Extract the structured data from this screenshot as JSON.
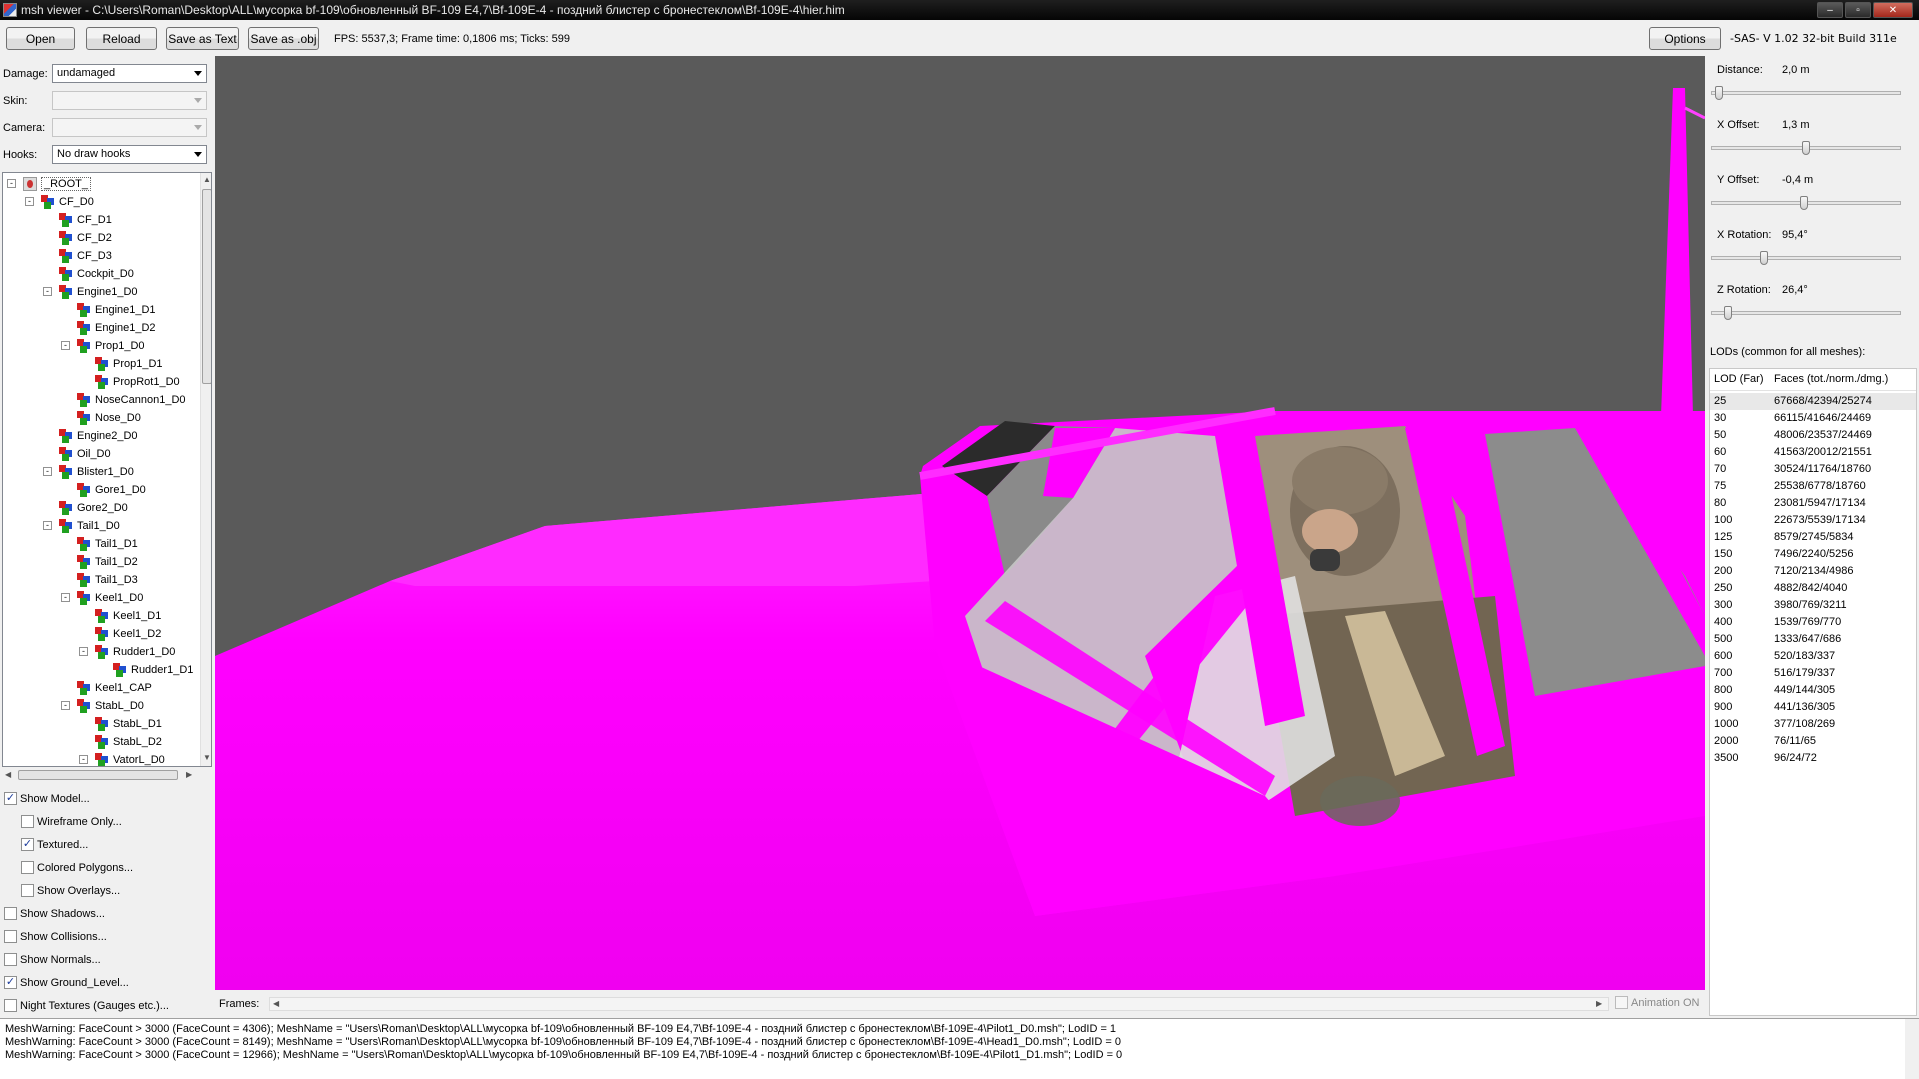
{
  "window": {
    "title": "msh viewer - C:\\Users\\Roman\\Desktop\\ALL\\мусорка bf-109\\обновленный BF-109 E4,7\\Bf-109E-4 - поздний блистер с бронестеклом\\Bf-109E-4\\hier.him",
    "controls": [
      "–",
      "▫",
      "✕"
    ]
  },
  "toolbar": {
    "open_label": "Open",
    "reload_label": "Reload",
    "save_text_label": "Save as Text",
    "save_obj_label": "Save as .obj",
    "fps_text": "FPS: 5537,3; Frame time: 0,1806 ms; Ticks: 599",
    "options_label": "Options",
    "version_text": "-SAS- V 1.02  32-bit  Build 311e"
  },
  "left": {
    "damage_label": "Damage:",
    "damage_value": "undamaged",
    "skin_label": "Skin:",
    "skin_value": "",
    "camera_label": "Camera:",
    "camera_value": "",
    "hooks_label": "Hooks:",
    "hooks_value": "No draw hooks",
    "tree": [
      {
        "label": "_ROOT_",
        "level": 0,
        "exp": "-",
        "root": true
      },
      {
        "label": "CF_D0",
        "level": 1,
        "exp": "-"
      },
      {
        "label": "CF_D1",
        "level": 2
      },
      {
        "label": "CF_D2",
        "level": 2
      },
      {
        "label": "CF_D3",
        "level": 2
      },
      {
        "label": "Cockpit_D0",
        "level": 2
      },
      {
        "label": "Engine1_D0",
        "level": 2,
        "exp": "-"
      },
      {
        "label": "Engine1_D1",
        "level": 3
      },
      {
        "label": "Engine1_D2",
        "level": 3
      },
      {
        "label": "Prop1_D0",
        "level": 3,
        "exp": "-"
      },
      {
        "label": "Prop1_D1",
        "level": 4
      },
      {
        "label": "PropRot1_D0",
        "level": 4
      },
      {
        "label": "NoseCannon1_D0",
        "level": 3
      },
      {
        "label": "Nose_D0",
        "level": 3
      },
      {
        "label": "Engine2_D0",
        "level": 2
      },
      {
        "label": "Oil_D0",
        "level": 2
      },
      {
        "label": "Blister1_D0",
        "level": 2,
        "exp": "-"
      },
      {
        "label": "Gore1_D0",
        "level": 3
      },
      {
        "label": "Gore2_D0",
        "level": 2
      },
      {
        "label": "Tail1_D0",
        "level": 2,
        "exp": "-"
      },
      {
        "label": "Tail1_D1",
        "level": 3
      },
      {
        "label": "Tail1_D2",
        "level": 3
      },
      {
        "label": "Tail1_D3",
        "level": 3
      },
      {
        "label": "Keel1_D0",
        "level": 3,
        "exp": "-"
      },
      {
        "label": "Keel1_D1",
        "level": 4
      },
      {
        "label": "Keel1_D2",
        "level": 4
      },
      {
        "label": "Rudder1_D0",
        "level": 4,
        "exp": "-"
      },
      {
        "label": "Rudder1_D1",
        "level": 5
      },
      {
        "label": "Keel1_CAP",
        "level": 3
      },
      {
        "label": "StabL_D0",
        "level": 3,
        "exp": "-"
      },
      {
        "label": "StabL_D1",
        "level": 4
      },
      {
        "label": "StabL_D2",
        "level": 4
      },
      {
        "label": "VatorL_D0",
        "level": 4,
        "exp": "-"
      }
    ],
    "checkboxes": [
      {
        "label": "Show Model...",
        "checked": true,
        "indent": 0
      },
      {
        "label": "Wireframe Only...",
        "checked": false,
        "indent": 1
      },
      {
        "label": "Textured...",
        "checked": true,
        "indent": 1
      },
      {
        "label": "Colored Polygons...",
        "checked": false,
        "indent": 1
      },
      {
        "label": "Show Overlays...",
        "checked": false,
        "indent": 1
      },
      {
        "label": "Show Shadows...",
        "checked": false,
        "indent": 0
      },
      {
        "label": "Show Collisions...",
        "checked": false,
        "indent": 0
      },
      {
        "label": "Show Normals...",
        "checked": false,
        "indent": 0
      },
      {
        "label": "Show Ground_Level...",
        "checked": true,
        "indent": 0
      },
      {
        "label": "Night Textures (Gauges etc.)...",
        "checked": false,
        "indent": 0
      }
    ]
  },
  "frames": {
    "label": "Frames:",
    "animation_label": "Animation ON",
    "animation_on": false
  },
  "right": {
    "sliders": [
      {
        "label": "Distance:",
        "value": "2,0 m",
        "position": 0.02
      },
      {
        "label": "X Offset:",
        "value": "1,3 m",
        "position": 0.5
      },
      {
        "label": "Y Offset:",
        "value": "-0,4 m",
        "position": 0.49
      },
      {
        "label": "X Rotation:",
        "value": "95,4°",
        "position": 0.27
      },
      {
        "label": "Z Rotation:",
        "value": "26,4°",
        "position": 0.07
      }
    ],
    "lods_title": "LODs (common for all meshes):",
    "lod_headers": [
      "LOD (Far)",
      "Faces (tot./norm./dmg.)"
    ],
    "lods": [
      [
        "25",
        "67668/42394/25274"
      ],
      [
        "30",
        "66115/41646/24469"
      ],
      [
        "50",
        "48006/23537/24469"
      ],
      [
        "60",
        "41563/20012/21551"
      ],
      [
        "70",
        "30524/11764/18760"
      ],
      [
        "75",
        "25538/6778/18760"
      ],
      [
        "80",
        "23081/5947/17134"
      ],
      [
        "100",
        "22673/5539/17134"
      ],
      [
        "125",
        "8579/2745/5834"
      ],
      [
        "150",
        "7496/2240/5256"
      ],
      [
        "200",
        "7120/2134/4986"
      ],
      [
        "250",
        "4882/842/4040"
      ],
      [
        "300",
        "3980/769/3211"
      ],
      [
        "400",
        "1539/769/770"
      ],
      [
        "500",
        "1333/647/686"
      ],
      [
        "600",
        "520/183/337"
      ],
      [
        "700",
        "516/179/337"
      ],
      [
        "800",
        "449/144/305"
      ],
      [
        "900",
        "441/136/305"
      ],
      [
        "1000",
        "377/108/269"
      ],
      [
        "2000",
        "76/11/65"
      ],
      [
        "3500",
        "96/24/72"
      ]
    ]
  },
  "log": [
    "MeshWarning: FaceCount > 3000 (FaceCount = 4306); MeshName = \"Users\\Roman\\Desktop\\ALL\\мусорка bf-109\\обновленный BF-109 E4,7\\Bf-109E-4 - поздний блистер с бронестеклом\\Bf-109E-4\\Pilot1_D0.msh\"; LodID = 1",
    "MeshWarning: FaceCount > 3000 (FaceCount = 8149); MeshName = \"Users\\Roman\\Desktop\\ALL\\мусорка bf-109\\обновленный BF-109 E4,7\\Bf-109E-4 - поздний блистер с бронестеклом\\Bf-109E-4\\Head1_D0.msh\"; LodID = 0",
    "MeshWarning: FaceCount > 3000 (FaceCount = 12966); MeshName = \"Users\\Roman\\Desktop\\ALL\\мусорка bf-109\\обновленный BF-109 E4,7\\Bf-109E-4 - поздний блистер с бронестеклом\\Bf-109E-4\\Pilot1_D1.msh\"; LodID = 0"
  ],
  "colors": {
    "fuselage": "#ff00ff",
    "background": "#5a5a5a",
    "glass": "#d8d8d8"
  }
}
